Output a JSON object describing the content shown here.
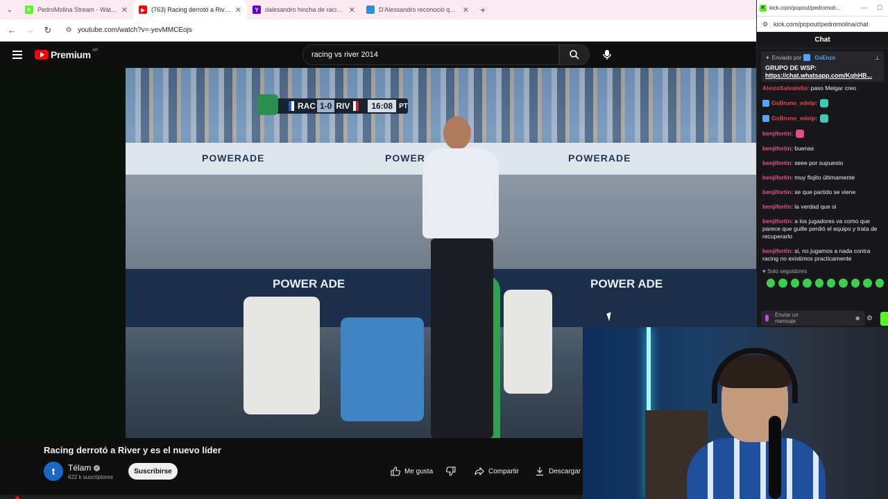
{
  "browser": {
    "tabs": [
      {
        "title": "PedroMolina Stream - Watch Li",
        "fav_color": "#53fc18",
        "fav_glyph": "K",
        "active": false
      },
      {
        "title": "(763) Racing derrotó a River y e",
        "fav_color": "#ff0000",
        "fav_glyph": "▶",
        "active": true
      },
      {
        "title": "dalesandro hincha de racing - Y",
        "fav_color": "#6001d2",
        "fav_glyph": "Y",
        "active": false
      },
      {
        "title": "D'Alessandro reconoció que es",
        "fav_color": "#2d8fd5",
        "fav_glyph": "",
        "active": false
      }
    ],
    "new_tab": "+",
    "url": "youtube.com/watch?v=-yevMMCEojs"
  },
  "youtube": {
    "logo_text": "Premium",
    "country": "AR",
    "search_value": "racing vs river 2014"
  },
  "video": {
    "scoreboard": {
      "home": "RAC",
      "score": "1-0",
      "away": "RIV",
      "clock": "16:08",
      "half": "PT"
    },
    "board_text": "POWERADE",
    "wall_text": "POWER ADE"
  },
  "below": {
    "title": "Racing derrotó a River y es el nuevo líder",
    "channel": "Télam",
    "channel_initial": "t",
    "subscribers": "622 k suscriptores",
    "subscribe_label": "Suscribirse",
    "like_label": "Me gusta",
    "share_label": "Compartir",
    "download_label": "Descargar"
  },
  "chat": {
    "window_url": "kick.com/popout/pedromoli...",
    "url": "kick.com/popout/pedromolina/chat",
    "header": "Chat",
    "pinned": {
      "sent_by_label": "Enviado por",
      "sender": "GsEnzo",
      "body": "GRUPO DE WSP:",
      "link": "https://chat.whatsapp.com/KqhHB..."
    },
    "messages": [
      {
        "user": "AlexisSalvatello",
        "text": "paso Melgar creo",
        "color": "red"
      },
      {
        "user": "GsBruno_edelp",
        "text": "",
        "color": "red",
        "emote": "#40c9b5"
      },
      {
        "user": "GsBruno_edelp",
        "text": "",
        "color": "red",
        "emote": "#40c9b5"
      },
      {
        "user": "benjifortin",
        "text": "",
        "color": "pink",
        "emote": "#e94a8b"
      },
      {
        "user": "benjifortin",
        "text": "buenas",
        "color": "pink"
      },
      {
        "user": "benjifortin",
        "text": "seee por supuesto",
        "color": "pink"
      },
      {
        "user": "benjifortin",
        "text": "muy flojito últimamente",
        "color": "pink"
      },
      {
        "user": "benjifortin",
        "text": "se que partido se viene",
        "color": "pink"
      },
      {
        "user": "benjifortin",
        "text": "la verdad que si",
        "color": "pink"
      },
      {
        "user": "benjifortin",
        "text": "a los jugadores va como que parece que guille perdió el equipo y trata de recuperarlo",
        "color": "pink"
      },
      {
        "user": "benjifortin",
        "text": "si, no jugamos a nada contra racing no existimos practicamente",
        "color": "pink"
      }
    ],
    "followers_only": "Solo seguidores",
    "input_placeholder": "Enviar un mensaje"
  }
}
